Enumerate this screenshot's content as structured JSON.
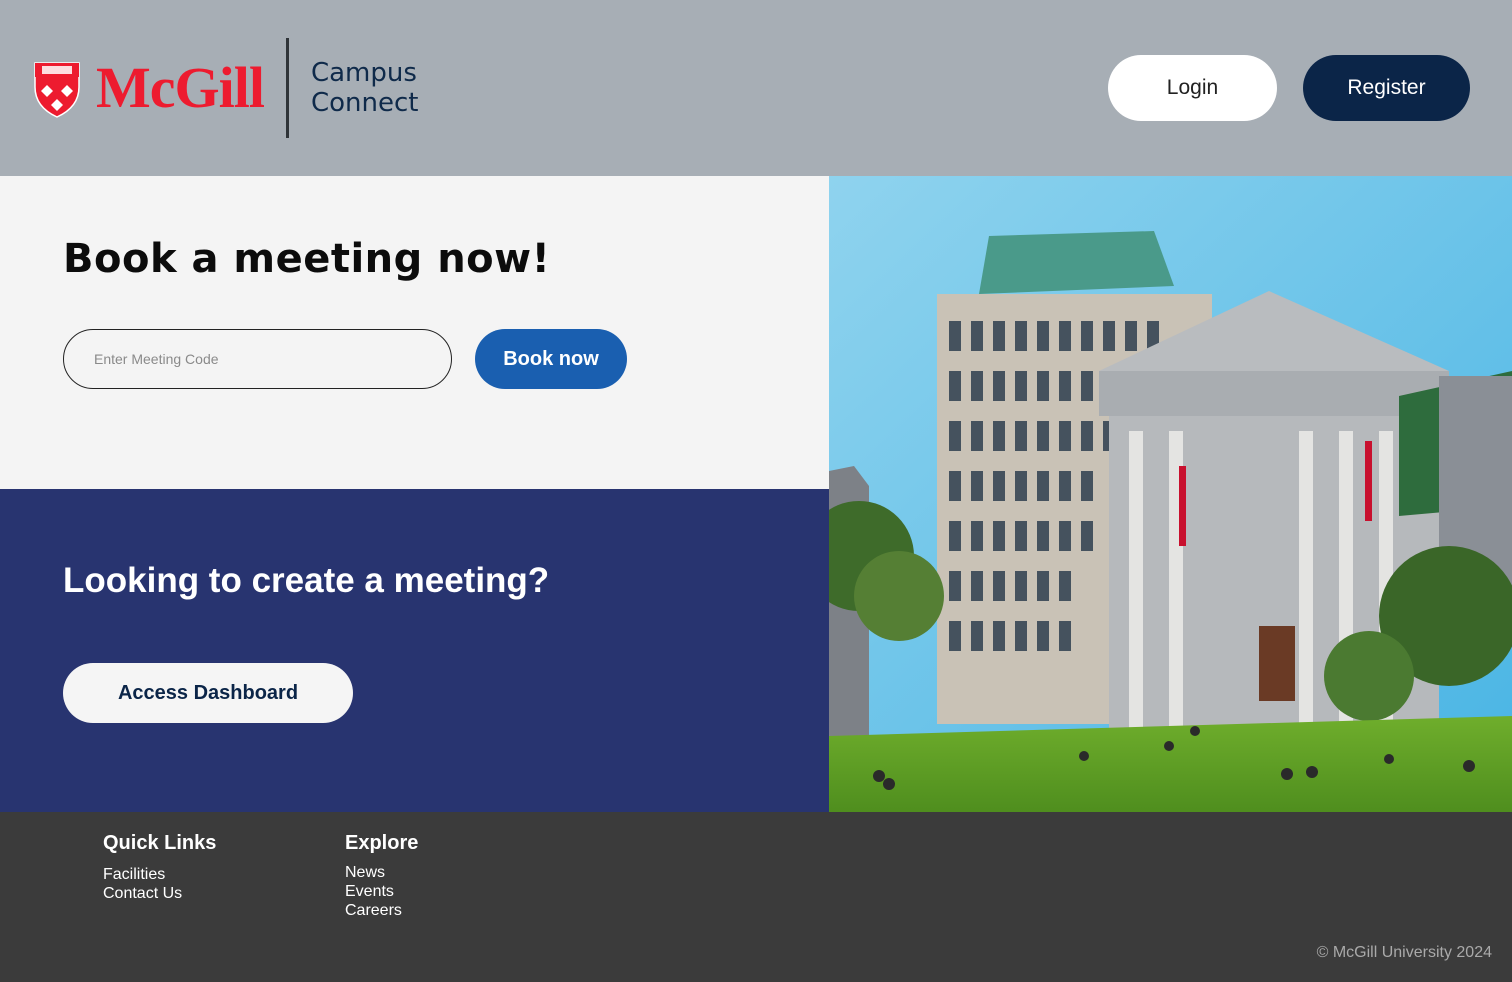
{
  "header": {
    "logo_wordmark": "McGill",
    "product_line1": "Campus",
    "product_line2": "Connect",
    "login_label": "Login",
    "register_label": "Register"
  },
  "book": {
    "title": "Book a meeting now!",
    "input_placeholder": "Enter Meeting Code",
    "input_value": "",
    "button_label": "Book now"
  },
  "create": {
    "title": "Looking to create a meeting?",
    "button_label": "Access Dashboard"
  },
  "footer": {
    "quick_links": {
      "heading": "Quick Links",
      "items": [
        "Facilities",
        "Contact Us"
      ]
    },
    "explore": {
      "heading": "Explore",
      "items": [
        "News",
        "Events",
        "Careers"
      ]
    },
    "copyright": "© McGill University 2024"
  },
  "colors": {
    "header_bg": "#a7aeb5",
    "brand_red": "#ed1b2f",
    "navy": "#0b2548",
    "book_blue": "#1a5fb0",
    "create_bg": "#283470",
    "footer_bg": "#3b3b3b"
  },
  "icons": {
    "crest": "mcgill-crest-icon"
  }
}
